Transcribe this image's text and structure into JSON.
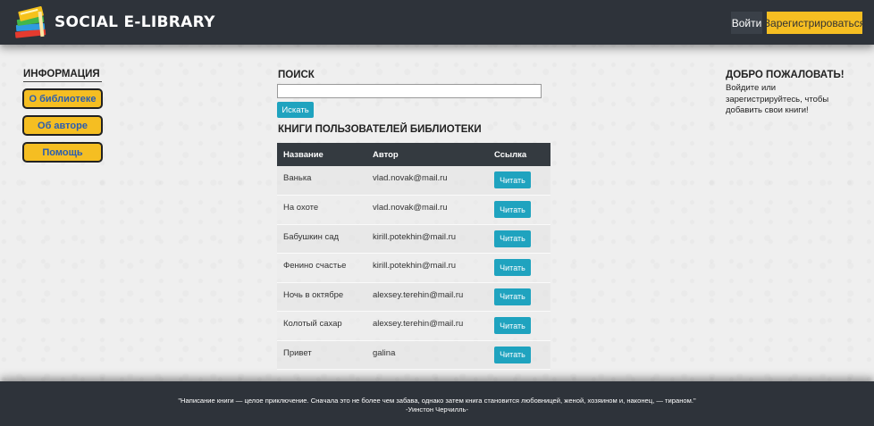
{
  "header": {
    "brand": "SOCIAL E-LIBRARY",
    "login_label": "Войти",
    "register_label": "Зарегистрироваться"
  },
  "sidebar": {
    "heading": "ИНФОРМАЦИЯ",
    "items": [
      {
        "label": "О библиотеке"
      },
      {
        "label": "Об авторе"
      },
      {
        "label": "Помощь"
      }
    ]
  },
  "search": {
    "heading": "ПОИСК",
    "value": "",
    "button_label": "Искать"
  },
  "books": {
    "heading": "КНИГИ ПОЛЬЗОВАТЕЛЕЙ БИБЛИОТЕКИ",
    "columns": [
      "Название",
      "Автор",
      "Ссылка"
    ],
    "rows": [
      {
        "title": "Ванька",
        "author": "vlad.novak@mail.ru",
        "link": "Читать"
      },
      {
        "title": "На охоте",
        "author": "vlad.novak@mail.ru",
        "link": "Читать"
      },
      {
        "title": "Бабушкин сад",
        "author": "kirill.potekhin@mail.ru",
        "link": "Читать"
      },
      {
        "title": "Фенино счастье",
        "author": "kirill.potekhin@mail.ru",
        "link": "Читать"
      },
      {
        "title": "Ночь в октябре",
        "author": "alexsey.terehin@mail.ru",
        "link": "Читать"
      },
      {
        "title": "Колотый сахар",
        "author": "alexsey.terehin@mail.ru",
        "link": "Читать"
      },
      {
        "title": "Привет",
        "author": "galina",
        "link": "Читать"
      }
    ]
  },
  "welcome": {
    "heading": "ДОБРО ПОЖАЛОВАТЬ!",
    "text": "Войдите или зарегистрируйтесь, чтобы добавить свои книги!"
  },
  "footer": {
    "quote": "\"Написание книги — целое приключение. Сначала это не более чем забава, однако затем книга становится любовницей, женой, хозяином и, наконец, — тираном.\"",
    "author": "-Уинстон Черчилль-"
  },
  "colors": {
    "header_bg": "#2e333a",
    "accent_yellow": "#f5be22",
    "button_teal": "#1fa3bf",
    "table_header": "#343a40"
  }
}
